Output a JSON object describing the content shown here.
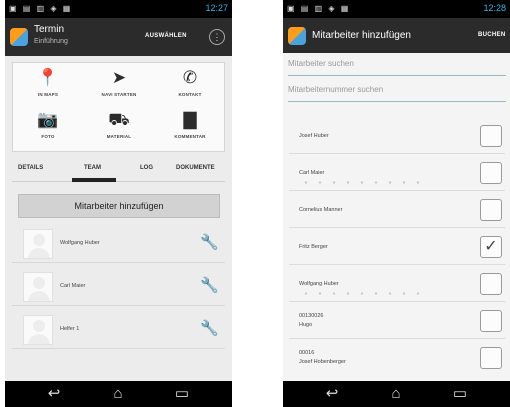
{
  "left_screen": {
    "statusbar": {
      "icons": "▣ ▤ ▥ ◈ ▦",
      "time": "12:27"
    },
    "actionbar": {
      "title": "Termin",
      "subtitle": "Einführung",
      "action_label": "AUSWÄHLEN",
      "overflow": "⋮"
    },
    "actions": [
      {
        "icon": "map-pin",
        "glyph": "📍",
        "label": "IN MAPS"
      },
      {
        "icon": "navigation-arrow",
        "glyph": "➤",
        "label": "NAVI STARTEN"
      },
      {
        "icon": "phone",
        "glyph": "✆",
        "label": "KONTAKT"
      },
      {
        "icon": "camera",
        "glyph": "📷",
        "label": "FOTO"
      },
      {
        "icon": "material",
        "glyph": "⛟",
        "label": "MATERIAL"
      },
      {
        "icon": "comment",
        "glyph": "▇",
        "label": "KOMMENTAR"
      }
    ],
    "tabs": [
      "DETAILS",
      "TEAM",
      "LOG",
      "DOKUMENTE"
    ],
    "active_tab": "TEAM",
    "add_button": "Mitarbeiter hinzufügen",
    "team": [
      {
        "name": "Wolfgang Huber"
      },
      {
        "name": "Carl Maier"
      },
      {
        "name": "Helfer 1"
      }
    ],
    "wrench_glyph": "🔧"
  },
  "right_screen": {
    "statusbar": {
      "icons": "▣ ▤ ▥ ◈ ▦",
      "time": "12:28"
    },
    "actionbar": {
      "title": "Mitarbeiter hinzufügen",
      "action_label": "BUCHEN"
    },
    "search_placeholder": "Mitarbeiter suchen",
    "number_placeholder": "Mitarbeiternummer suchen",
    "employees": [
      {
        "line1": "Josef Huber",
        "line2": "",
        "checked": false
      },
      {
        "line1": "Carl Maier",
        "line2": "",
        "checked": false
      },
      {
        "line1": "Cornelius Manner",
        "line2": "",
        "checked": false
      },
      {
        "line1": "Fritz Berger",
        "line2": "",
        "checked": true
      },
      {
        "line1": "Wolfgang Huber",
        "line2": "",
        "checked": false
      },
      {
        "line1": "00130026",
        "line2": "Hugo",
        "checked": false
      },
      {
        "line1": "00016",
        "line2": "Josef Hobenberger",
        "checked": false
      }
    ],
    "check_glyph": "✓"
  },
  "navbar": {
    "back": "↩",
    "home": "⌂",
    "recent": "▭"
  },
  "colors": {
    "statusbar": "#000000",
    "actionbar": "#2b2b2b",
    "accent": "#35b5e5",
    "background": "#ececec"
  }
}
